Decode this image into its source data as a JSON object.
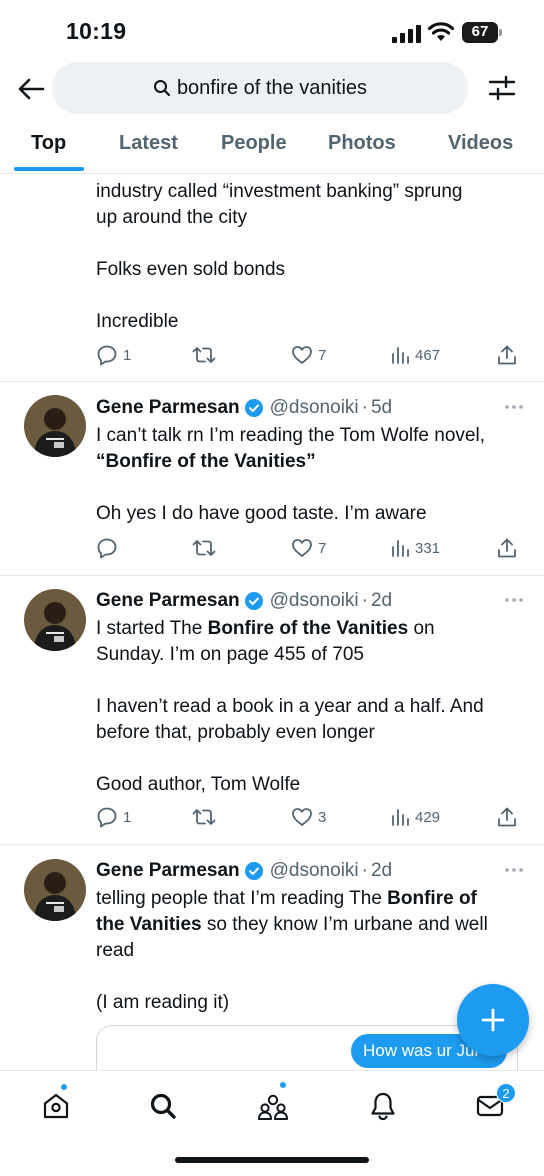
{
  "status_bar": {
    "time": "10:19",
    "battery": "67"
  },
  "search": {
    "query": "bonfire of the vanities"
  },
  "tabs": [
    {
      "label": "Top"
    },
    {
      "label": "Latest"
    },
    {
      "label": "People"
    },
    {
      "label": "Photos"
    },
    {
      "label": "Videos"
    }
  ],
  "posts": [
    {
      "paragraphs": [
        "industry called “investment banking” sprung",
        "up around the city",
        "Folks even sold bonds",
        "Incredible"
      ],
      "replies": "1",
      "reposts": "",
      "likes": "7",
      "views": "467"
    },
    {
      "author": "Gene Parmesan",
      "handle": "@dsonoiki",
      "time": "5d",
      "line1": "I can’t talk rn I’m reading the Tom Wolfe novel,",
      "line2_bold": "“Bonfire of the Vanities”",
      "line3": "Oh yes I do have good taste. I’m aware",
      "replies": "",
      "reposts": "",
      "likes": "7",
      "views": "331"
    },
    {
      "author": "Gene Parmesan",
      "handle": "@dsonoiki",
      "time": "2d",
      "l1_a": "I started The ",
      "l1_b": "Bonfire of the Vanities",
      "l1_c": " on",
      "l2": "Sunday. I’m on page 455 of 705",
      "l3": "I haven’t read a book in a year and a half. And",
      "l4": "before that, probably even longer",
      "l5": "Good author, Tom Wolfe",
      "replies": "1",
      "reposts": "",
      "likes": "3",
      "views": "429"
    },
    {
      "author": "Gene Parmesan",
      "handle": "@dsonoiki",
      "time": "2d",
      "l1_a": "telling people that I’m reading The ",
      "l1_b": "Bonfire of",
      "l2_a": "the Vanities",
      "l2_b": " so they know I’m urbane and well",
      "l3": "read",
      "l4": "(I am reading it)"
    }
  ],
  "dm_preview": "How was ur Jul",
  "nav": {
    "messages_badge": "2"
  },
  "colors": {
    "accent": "#1d9bf0",
    "text": "#0f1419",
    "secondary": "#536471"
  }
}
